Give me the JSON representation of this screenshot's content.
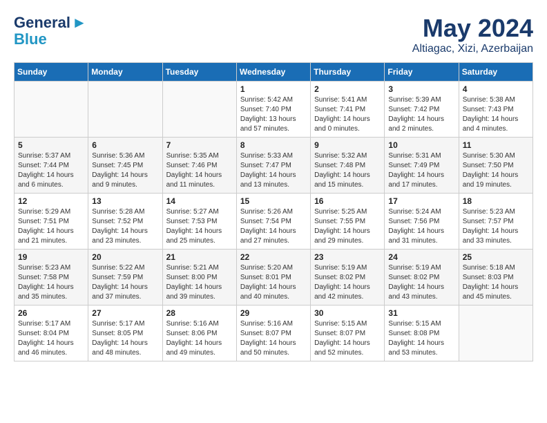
{
  "header": {
    "logo_general": "General",
    "logo_blue": "Blue",
    "month": "May 2024",
    "location": "Altiagac, Xizi, Azerbaijan"
  },
  "days_of_week": [
    "Sunday",
    "Monday",
    "Tuesday",
    "Wednesday",
    "Thursday",
    "Friday",
    "Saturday"
  ],
  "weeks": [
    [
      {
        "day": "",
        "info": ""
      },
      {
        "day": "",
        "info": ""
      },
      {
        "day": "",
        "info": ""
      },
      {
        "day": "1",
        "info": "Sunrise: 5:42 AM\nSunset: 7:40 PM\nDaylight: 13 hours\nand 57 minutes."
      },
      {
        "day": "2",
        "info": "Sunrise: 5:41 AM\nSunset: 7:41 PM\nDaylight: 14 hours\nand 0 minutes."
      },
      {
        "day": "3",
        "info": "Sunrise: 5:39 AM\nSunset: 7:42 PM\nDaylight: 14 hours\nand 2 minutes."
      },
      {
        "day": "4",
        "info": "Sunrise: 5:38 AM\nSunset: 7:43 PM\nDaylight: 14 hours\nand 4 minutes."
      }
    ],
    [
      {
        "day": "5",
        "info": "Sunrise: 5:37 AM\nSunset: 7:44 PM\nDaylight: 14 hours\nand 6 minutes."
      },
      {
        "day": "6",
        "info": "Sunrise: 5:36 AM\nSunset: 7:45 PM\nDaylight: 14 hours\nand 9 minutes."
      },
      {
        "day": "7",
        "info": "Sunrise: 5:35 AM\nSunset: 7:46 PM\nDaylight: 14 hours\nand 11 minutes."
      },
      {
        "day": "8",
        "info": "Sunrise: 5:33 AM\nSunset: 7:47 PM\nDaylight: 14 hours\nand 13 minutes."
      },
      {
        "day": "9",
        "info": "Sunrise: 5:32 AM\nSunset: 7:48 PM\nDaylight: 14 hours\nand 15 minutes."
      },
      {
        "day": "10",
        "info": "Sunrise: 5:31 AM\nSunset: 7:49 PM\nDaylight: 14 hours\nand 17 minutes."
      },
      {
        "day": "11",
        "info": "Sunrise: 5:30 AM\nSunset: 7:50 PM\nDaylight: 14 hours\nand 19 minutes."
      }
    ],
    [
      {
        "day": "12",
        "info": "Sunrise: 5:29 AM\nSunset: 7:51 PM\nDaylight: 14 hours\nand 21 minutes."
      },
      {
        "day": "13",
        "info": "Sunrise: 5:28 AM\nSunset: 7:52 PM\nDaylight: 14 hours\nand 23 minutes."
      },
      {
        "day": "14",
        "info": "Sunrise: 5:27 AM\nSunset: 7:53 PM\nDaylight: 14 hours\nand 25 minutes."
      },
      {
        "day": "15",
        "info": "Sunrise: 5:26 AM\nSunset: 7:54 PM\nDaylight: 14 hours\nand 27 minutes."
      },
      {
        "day": "16",
        "info": "Sunrise: 5:25 AM\nSunset: 7:55 PM\nDaylight: 14 hours\nand 29 minutes."
      },
      {
        "day": "17",
        "info": "Sunrise: 5:24 AM\nSunset: 7:56 PM\nDaylight: 14 hours\nand 31 minutes."
      },
      {
        "day": "18",
        "info": "Sunrise: 5:23 AM\nSunset: 7:57 PM\nDaylight: 14 hours\nand 33 minutes."
      }
    ],
    [
      {
        "day": "19",
        "info": "Sunrise: 5:23 AM\nSunset: 7:58 PM\nDaylight: 14 hours\nand 35 minutes."
      },
      {
        "day": "20",
        "info": "Sunrise: 5:22 AM\nSunset: 7:59 PM\nDaylight: 14 hours\nand 37 minutes."
      },
      {
        "day": "21",
        "info": "Sunrise: 5:21 AM\nSunset: 8:00 PM\nDaylight: 14 hours\nand 39 minutes."
      },
      {
        "day": "22",
        "info": "Sunrise: 5:20 AM\nSunset: 8:01 PM\nDaylight: 14 hours\nand 40 minutes."
      },
      {
        "day": "23",
        "info": "Sunrise: 5:19 AM\nSunset: 8:02 PM\nDaylight: 14 hours\nand 42 minutes."
      },
      {
        "day": "24",
        "info": "Sunrise: 5:19 AM\nSunset: 8:02 PM\nDaylight: 14 hours\nand 43 minutes."
      },
      {
        "day": "25",
        "info": "Sunrise: 5:18 AM\nSunset: 8:03 PM\nDaylight: 14 hours\nand 45 minutes."
      }
    ],
    [
      {
        "day": "26",
        "info": "Sunrise: 5:17 AM\nSunset: 8:04 PM\nDaylight: 14 hours\nand 46 minutes."
      },
      {
        "day": "27",
        "info": "Sunrise: 5:17 AM\nSunset: 8:05 PM\nDaylight: 14 hours\nand 48 minutes."
      },
      {
        "day": "28",
        "info": "Sunrise: 5:16 AM\nSunset: 8:06 PM\nDaylight: 14 hours\nand 49 minutes."
      },
      {
        "day": "29",
        "info": "Sunrise: 5:16 AM\nSunset: 8:07 PM\nDaylight: 14 hours\nand 50 minutes."
      },
      {
        "day": "30",
        "info": "Sunrise: 5:15 AM\nSunset: 8:07 PM\nDaylight: 14 hours\nand 52 minutes."
      },
      {
        "day": "31",
        "info": "Sunrise: 5:15 AM\nSunset: 8:08 PM\nDaylight: 14 hours\nand 53 minutes."
      },
      {
        "day": "",
        "info": ""
      }
    ]
  ]
}
